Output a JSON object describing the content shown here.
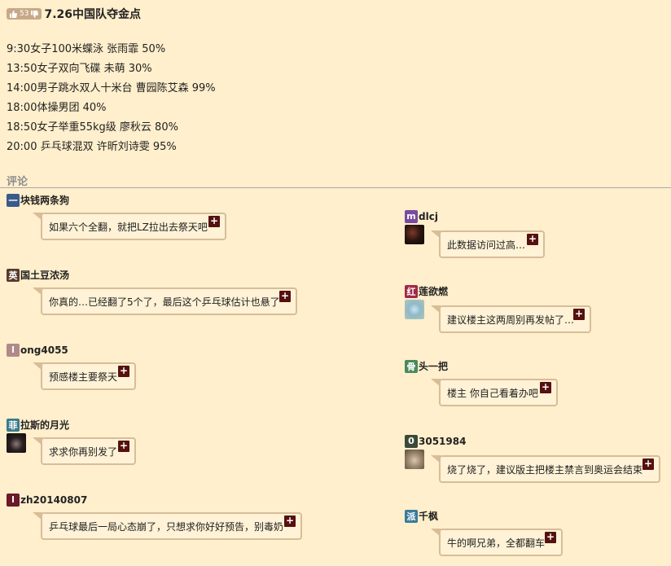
{
  "post": {
    "vote_count": "53",
    "title": "7.26中国队夺金点",
    "schedule": [
      "9:30女子100米蝶泳 张雨霏 50%",
      "13:50女子双向飞碟 未萌 30%",
      "14:00男子跳水双人十米台 曹园陈艾森 99%",
      "18:00体操男团 40%",
      "18:50女子举重55kg级 廖秋云 80%",
      "20:00 乒乓球混双 许昕刘诗雯 95%"
    ]
  },
  "comments_label": "评论",
  "comments": [
    {
      "avatar_char": "一",
      "avatar_color": "#3a5a8a",
      "username": "块钱两条狗",
      "text": "如果六个全翻，就把LZ拉出去祭天吧"
    },
    {
      "avatar_char": "英",
      "avatar_color": "#5a3a2e",
      "username": "国土豆浓汤",
      "text": "你真的…已经翻了5个了，最后这个乒乓球估计也悬了"
    },
    {
      "avatar_char": "l",
      "avatar_color": "#b08a8a",
      "username": "ong4055",
      "text": "预感楼主要祭天"
    },
    {
      "avatar_char": "菲",
      "avatar_color": "#3a7a8a",
      "username": "拉斯的月光",
      "text": "求求你再别发了"
    },
    {
      "avatar_char": "l",
      "avatar_color": "#6a1a2a",
      "username": "zh20140807",
      "text": "乒乓球最后一局心态崩了，只想求你好好预告，别毒奶"
    },
    {
      "avatar_char": "m",
      "avatar_color": "#7a4aa0",
      "username": "dlcj",
      "text": "此数据访问过高…"
    },
    {
      "avatar_char": "红",
      "avatar_color": "#a02a4a",
      "username": "莲欲燃",
      "text": "建议楼主这两周别再发帖了…"
    },
    {
      "avatar_char": "骨",
      "avatar_color": "#4a8a5a",
      "username": "头一把",
      "text": "楼主 你自己看着办吧"
    },
    {
      "avatar_char": "0",
      "avatar_color": "#3a4a3a",
      "username": "3051984",
      "text": "烧了烧了，建议版主把楼主禁言到奥运会结束"
    },
    {
      "avatar_char": "派",
      "avatar_color": "#3a7a9a",
      "username": "千枫",
      "text": "牛的啊兄弟，全都翻车"
    }
  ],
  "expand_symbol": "+"
}
